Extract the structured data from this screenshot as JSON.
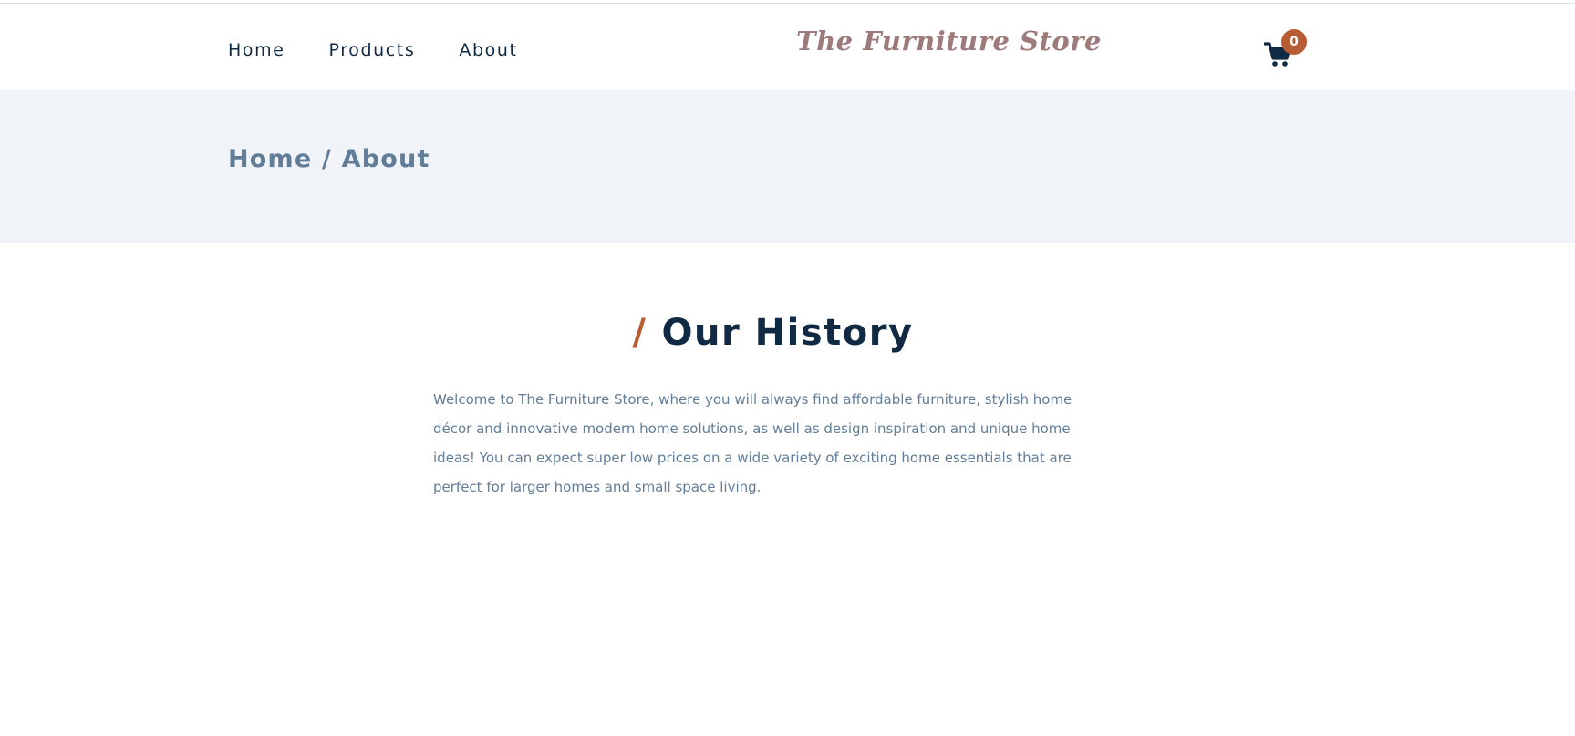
{
  "nav": {
    "links": [
      {
        "label": "Home"
      },
      {
        "label": "Products"
      },
      {
        "label": "About"
      }
    ]
  },
  "brand": {
    "name": "The Furniture Store"
  },
  "cart": {
    "count": "0",
    "icon": "cart-icon"
  },
  "hero": {
    "breadcrumb": "Home / About"
  },
  "history": {
    "slash": "/",
    "title": "Our History",
    "text": "Welcome to The Furniture Store, where you will always find affordable furniture, stylish home décor and innovative modern home solutions, as well as design inspiration and unique home ideas! You can expect super low prices on a wide variety of exciting home essentials that are perfect for larger homes and small space living."
  },
  "colors": {
    "primary": "#102a43",
    "accent": "#b85d33",
    "muted": "#627d98",
    "brand": "#9e7b7b",
    "hero_bg": "#f0f4f8"
  }
}
